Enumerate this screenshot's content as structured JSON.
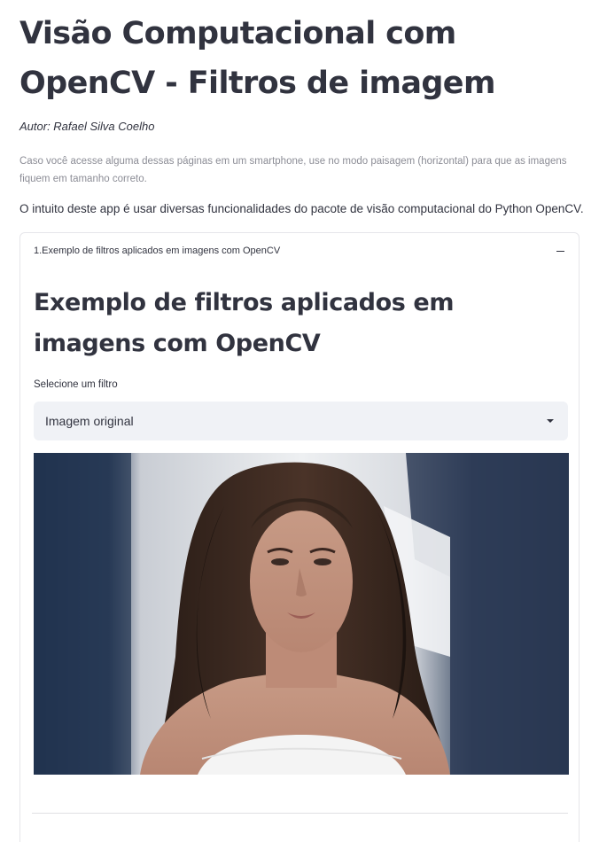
{
  "header": {
    "title": "Visão Computacional com OpenCV - Filtros de imagem",
    "author": "Autor: Rafael Silva Coelho",
    "note": "Caso você acesse alguma dessas páginas em um smartphone, use no modo paisagem (horizontal) para que as imagens fiquem em tamanho correto.",
    "intro": "O intuito deste app é usar diversas funcionalidades do pacote de visão computacional do Python OpenCV."
  },
  "expander": {
    "label": "1.Exemplo de filtros aplicados em imagens com OpenCV",
    "icon": "minus-icon",
    "expanded": true,
    "section_title": "Exemplo de filtros aplicados em imagens com OpenCV",
    "select": {
      "label": "Selecione um filtro",
      "value": "Imagem original",
      "icon": "caret-down-icon"
    },
    "image": {
      "subject": "portrait-photo"
    }
  },
  "colors": {
    "text": "#31333f",
    "muted": "#8c8d96",
    "select_bg": "#f0f2f6",
    "border": "#e6e6ea"
  }
}
